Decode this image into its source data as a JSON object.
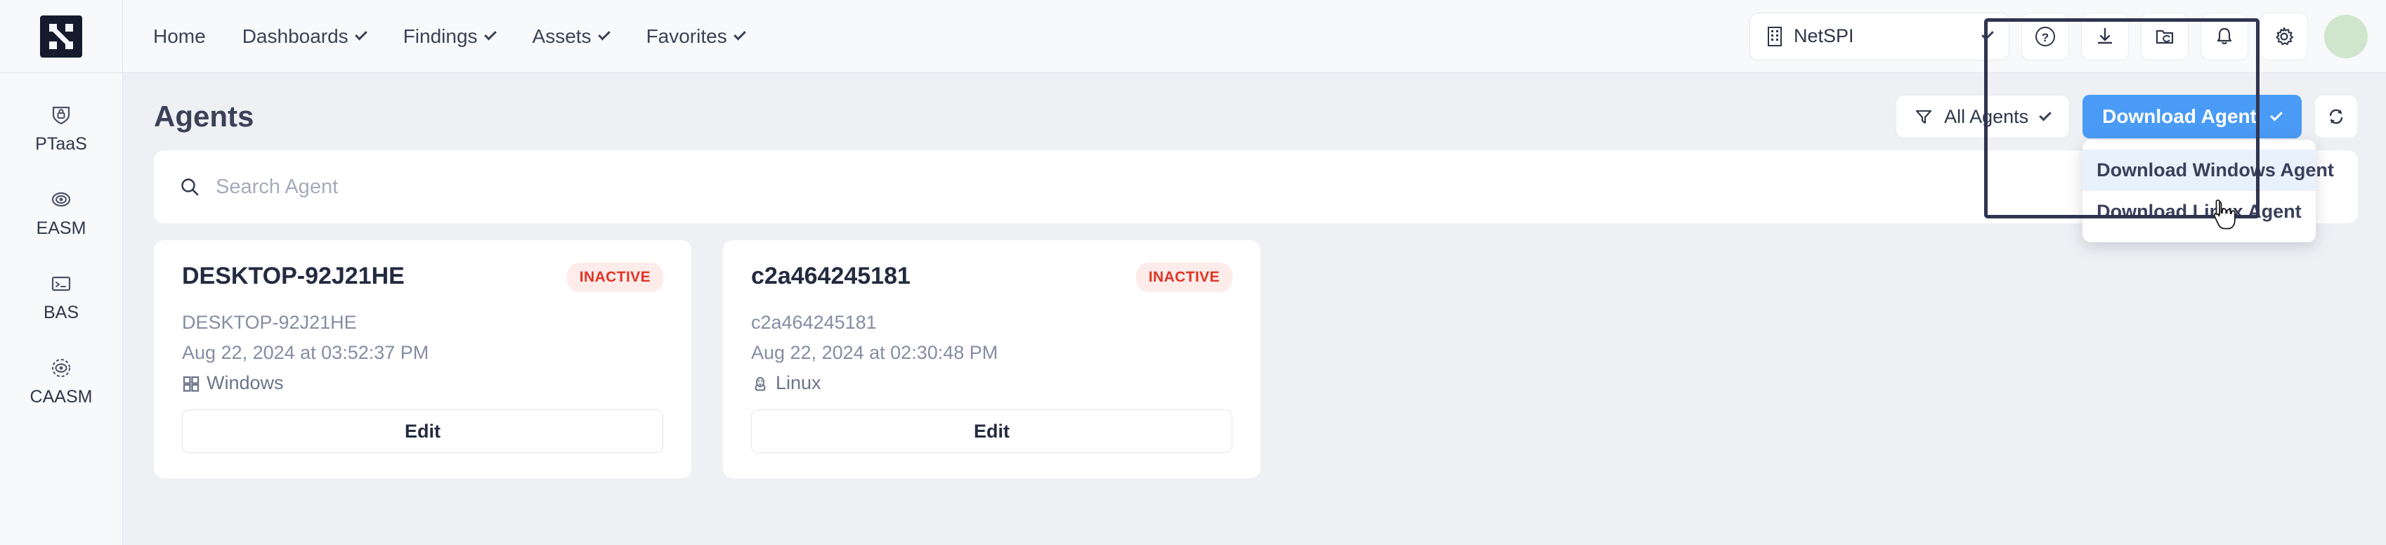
{
  "brand": {
    "logo_alt": "NetSPI"
  },
  "nav": {
    "items": [
      {
        "label": "Home",
        "has_caret": false
      },
      {
        "label": "Dashboards",
        "has_caret": true
      },
      {
        "label": "Findings",
        "has_caret": true
      },
      {
        "label": "Assets",
        "has_caret": true
      },
      {
        "label": "Favorites",
        "has_caret": true
      }
    ]
  },
  "header_right": {
    "org": "NetSPI",
    "icons": [
      "help-icon",
      "download-icon",
      "folder-sync-icon",
      "bell-icon",
      "gear-icon"
    ],
    "avatar_color": "#cfe6cc"
  },
  "sidebar": {
    "items": [
      {
        "label": "PTaaS",
        "icon": "shield-lock-icon"
      },
      {
        "label": "EASM",
        "icon": "target-eye-icon"
      },
      {
        "label": "BAS",
        "icon": "terminal-icon"
      },
      {
        "label": "CAASM",
        "icon": "dashed-eye-icon"
      }
    ]
  },
  "page": {
    "title": "Agents"
  },
  "toolbar": {
    "filter_label": "All Agents",
    "download_label": "Download Agent",
    "refresh_icon": "refresh-icon",
    "accent_color": "#4a9bf5"
  },
  "dropdown": {
    "open": true,
    "items": [
      {
        "label": "Download Windows Agent",
        "highlighted": true
      },
      {
        "label": "Download Linux Agent",
        "highlighted": false
      }
    ]
  },
  "search": {
    "value": "",
    "placeholder": "Search Agent"
  },
  "cards": [
    {
      "title": "DESKTOP-92J21HE",
      "status": "INACTIVE",
      "hostname": "DESKTOP-92J21HE",
      "date": "Aug 22, 2024 at 03:52:37 PM",
      "os": "Windows",
      "os_icon": "windows-icon",
      "edit_label": "Edit"
    },
    {
      "title": "c2a464245181",
      "status": "INACTIVE",
      "hostname": "c2a464245181",
      "date": "Aug 22, 2024 at 02:30:48 PM",
      "os": "Linux",
      "os_icon": "linux-icon",
      "edit_label": "Edit"
    }
  ],
  "colors": {
    "page_bg": "#eef0f4",
    "panel_bg": "#f8f9fb",
    "text": "#3b4257",
    "muted": "#868da3",
    "danger": "#e03424",
    "danger_bg": "#fdecea"
  }
}
